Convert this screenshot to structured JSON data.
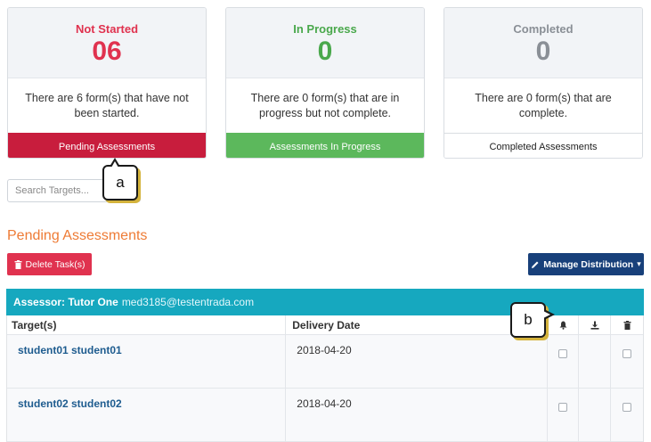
{
  "cards": [
    {
      "label": "Not Started",
      "count": "06",
      "description": "There are 6 form(s) that have not been started.",
      "button": "Pending Assessments",
      "color": "#e0324f"
    },
    {
      "label": "In Progress",
      "count": "0",
      "description": "There are 0 form(s) that are in progress but not complete.",
      "button": "Assessments In Progress",
      "color": "#4aa84c"
    },
    {
      "label": "Completed",
      "count": "0",
      "description": "There are 0 form(s) that are complete.",
      "button": "Completed Assessments",
      "color": "#8a8f96"
    }
  ],
  "search": {
    "placeholder": "Search Targets..."
  },
  "callouts": {
    "a": "a",
    "b": "b"
  },
  "section": {
    "title": "Pending Assessments"
  },
  "toolbar": {
    "delete_label": "Delete Task(s)",
    "delete_icon": "trash-icon",
    "manage_label": "Manage Distribution",
    "manage_icon": "pencil-icon",
    "manage_caret": "▾"
  },
  "assessor": {
    "label": "Assessor: Tutor One",
    "email": "med3185@testentrada.com",
    "color": "#16a8bf"
  },
  "table": {
    "headers": {
      "target": "Target(s)",
      "delivery": "Delivery Date",
      "col_icons": [
        "bell-icon",
        "download-icon",
        "trash-icon"
      ]
    },
    "rows": [
      {
        "target": "student01 student01",
        "delivery": "2018-04-20"
      },
      {
        "target": "student02 student02",
        "delivery": "2018-04-20"
      }
    ]
  }
}
